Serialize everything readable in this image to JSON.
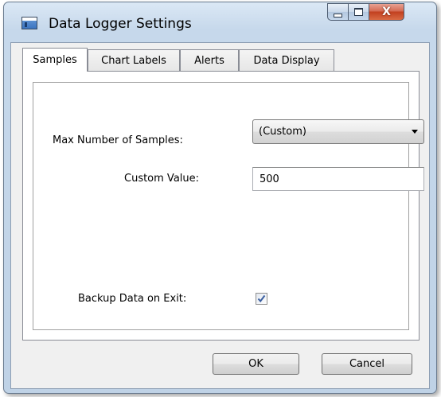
{
  "window": {
    "title": "Data Logger Settings",
    "icon": "app-window-icon",
    "caption_buttons": {
      "minimize_icon": "minimize-icon",
      "maximize_icon": "maximize-icon",
      "close_icon": "close-icon",
      "close_glyph": "X"
    }
  },
  "tabs": [
    {
      "label": "Samples",
      "active": true
    },
    {
      "label": "Chart Labels",
      "active": false
    },
    {
      "label": "Alerts",
      "active": false
    },
    {
      "label": "Data Display",
      "active": false
    }
  ],
  "samples": {
    "max_samples_label": "Max Number of Samples:",
    "max_samples_value": "(Custom)",
    "custom_value_label": "Custom Value:",
    "custom_value": "500",
    "backup_label": "Backup Data on Exit:",
    "backup_checked": true
  },
  "buttons": {
    "ok": "OK",
    "cancel": "Cancel"
  },
  "colors": {
    "checkmark": "#3b5fa0",
    "close_button": "#c2401f"
  }
}
